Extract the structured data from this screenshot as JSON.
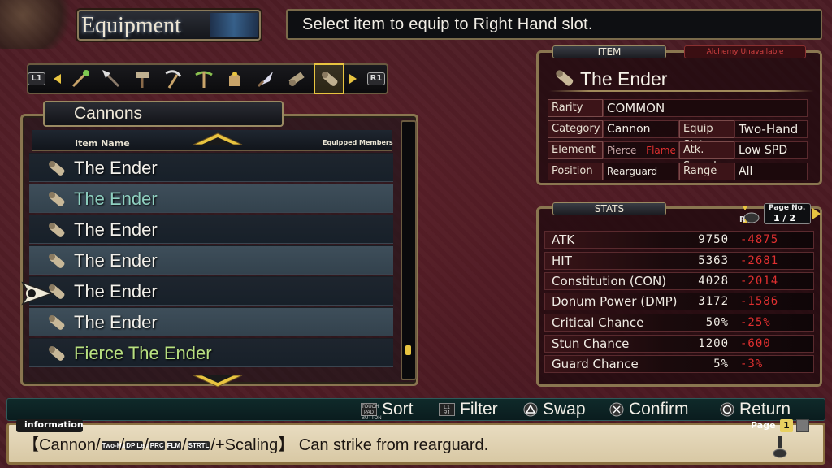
{
  "screen": {
    "title": "Equipment",
    "instruction": "Select item to equip to Right Hand slot."
  },
  "category_bar": {
    "left_shoulder": "L1",
    "right_shoulder": "R1",
    "icons": [
      "staff-icon",
      "spear-icon",
      "hammer-icon",
      "scythe-icon",
      "crossbow-icon",
      "bag-icon",
      "blade-icon",
      "gatling-icon",
      "cannon-icon"
    ],
    "selected_index": 8
  },
  "list": {
    "title": "Cannons",
    "header_item_name": "Item Name",
    "header_equipped": "Equipped Members",
    "items": [
      {
        "label": "The Ender",
        "style": "normal"
      },
      {
        "label": "The Ender",
        "style": "teal"
      },
      {
        "label": "The Ender",
        "style": "normal"
      },
      {
        "label": "The Ender",
        "style": "normal"
      },
      {
        "label": "The Ender",
        "style": "normal"
      },
      {
        "label": "The Ender",
        "style": "normal"
      },
      {
        "label": "Fierce The Ender",
        "style": "green"
      }
    ],
    "cursor_index": 4
  },
  "item": {
    "tab_label": "ITEM",
    "alchemy_label": "Alchemy Unavailable",
    "name": "The Ender",
    "rarity_label": "Rarity",
    "rarity": "COMMON",
    "category_label": "Category",
    "category": "Cannon",
    "equip_slot_label": "Equip Slot",
    "equip_slot": "Two-Hand",
    "element_label": "Element",
    "element_pierce": "Pierce",
    "element_flame": "Flame",
    "atk_speed_label": "Atk. Speed",
    "atk_speed": "Low SPD",
    "position_label": "Position",
    "position": "Rearguard",
    "range_label": "Range",
    "range": "All"
  },
  "stats": {
    "tab_label": "STATS",
    "page_label": "Page No.",
    "page_value": "1 / 2",
    "r_label": "R",
    "rows": [
      {
        "name": "ATK",
        "value": "9750",
        "delta": "-4875"
      },
      {
        "name": "HIT",
        "value": "5363",
        "delta": "-2681"
      },
      {
        "name": "Constitution (CON)",
        "value": "4028",
        "delta": "-2014"
      },
      {
        "name": "Donum Power (DMP)",
        "value": "3172",
        "delta": "-1586"
      },
      {
        "name": "Critical Chance",
        "value": "50%",
        "delta": "-25%"
      },
      {
        "name": "Stun Chance",
        "value": "1200",
        "delta": "-600"
      },
      {
        "name": "Guard Chance",
        "value": "5%",
        "delta": "-3%"
      }
    ]
  },
  "controls": {
    "sort": "Sort",
    "sort_btn": "TOUCH PAD BUTTON",
    "filter": "Filter",
    "filter_btn_top": "L1",
    "filter_btn_bottom": "R1",
    "swap": "Swap",
    "confirm": "Confirm",
    "return": "Return"
  },
  "info": {
    "tag": "information",
    "open_bracket": "【Cannon/",
    "icon_two_hand": "Two-Hand",
    "slash1": "/",
    "icon_dp_less": "DP Less",
    "slash2": "/",
    "icon_prc": "PRC",
    "icon_flm": "FLM",
    "slash3": "/",
    "icon_strtl": "STRTL",
    "tail": "/+Scaling】 Can strike from rearguard.",
    "page_label": "Page",
    "page_value": "1"
  },
  "colors": {
    "accent_gold": "#e8c440",
    "negative_red": "#e03030",
    "rare_teal": "#8fd0c0",
    "fierce_green": "#b8e080"
  }
}
